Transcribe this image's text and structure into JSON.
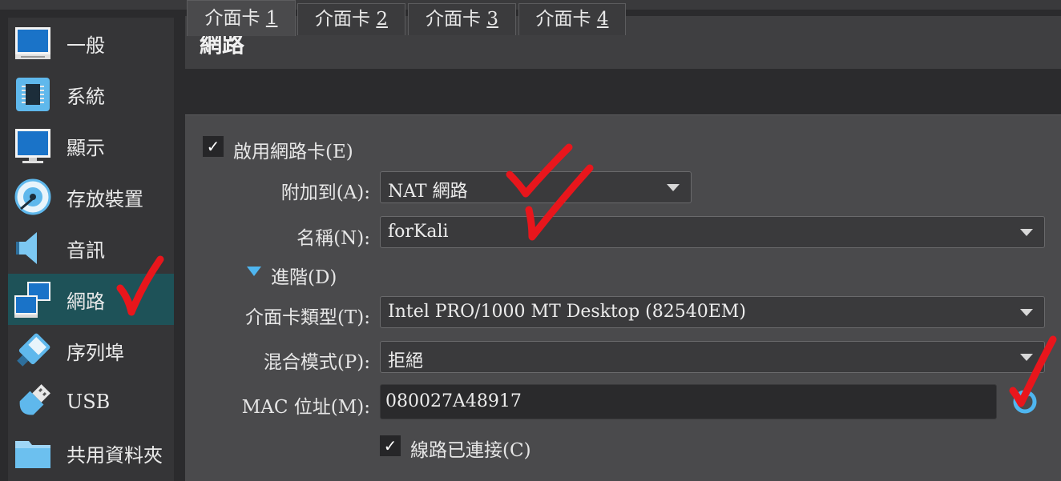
{
  "sidebar": {
    "items": [
      {
        "label": "一般",
        "icon": "monitor-icon"
      },
      {
        "label": "系統",
        "icon": "chip-icon"
      },
      {
        "label": "顯示",
        "icon": "display-icon"
      },
      {
        "label": "存放裝置",
        "icon": "disk-icon"
      },
      {
        "label": "音訊",
        "icon": "speaker-icon"
      },
      {
        "label": "網路",
        "icon": "network-icon",
        "selected": true
      },
      {
        "label": "序列埠",
        "icon": "serial-port-icon"
      },
      {
        "label": "USB",
        "icon": "usb-icon"
      },
      {
        "label": "共用資料夾",
        "icon": "folder-icon"
      }
    ]
  },
  "main": {
    "title": "網路",
    "tabs": [
      {
        "prefix": "介面卡 ",
        "num": "1",
        "active": true
      },
      {
        "prefix": "介面卡 ",
        "num": "2"
      },
      {
        "prefix": "介面卡 ",
        "num": "3"
      },
      {
        "prefix": "介面卡 ",
        "num": "4"
      }
    ],
    "enable_adapter": {
      "label": "啟用網路卡(E)",
      "checked": true,
      "check_mark": "✓"
    },
    "attached_to": {
      "label": "附加到(A):",
      "value": "NAT 網路"
    },
    "name": {
      "label": "名稱(N):",
      "value": "forKali"
    },
    "advanced": {
      "label": "進階(D)"
    },
    "adapter_type": {
      "label": "介面卡類型(T):",
      "value": "Intel PRO/1000 MT Desktop (82540EM)"
    },
    "promiscuous": {
      "label": "混合模式(P):",
      "value": "拒絕"
    },
    "mac": {
      "label": "MAC 位址(M):",
      "value": "080027A48917",
      "refresh_icon": "refresh-icon"
    },
    "cable_connected": {
      "label": "線路已連接(C)",
      "checked": true,
      "check_mark": "✓"
    }
  },
  "colors": {
    "background": "#2b2b2d",
    "sidebar": "#353537",
    "sidebar_selected": "#1e5258",
    "panel": "#4a4a4c",
    "accent_blue": "#4fb6f0",
    "annotation_red": "#e8161c"
  }
}
